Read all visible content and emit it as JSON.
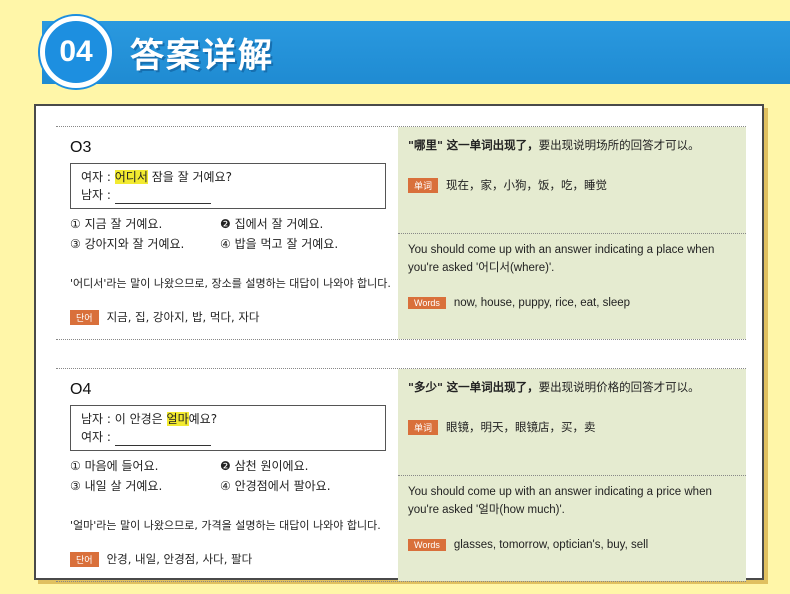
{
  "header": {
    "number": "04",
    "title": "答案详解"
  },
  "colors": {
    "header_blue": "#1f8bd2",
    "background": "#fff6a8",
    "tag_orange": "#d9703b",
    "panel_green": "#e5ebd0"
  },
  "q1": {
    "num": "O3",
    "line1_prefix": "여자 : ",
    "line1_highlight": "어디서",
    "line1_suffix": " 잠을 잘 거예요?",
    "line2_prefix": "남자 : ",
    "options": [
      "① 지금 잘 거예요.",
      "❷ 집에서 잘 거예요.",
      "③ 강아지와 잘 거예요.",
      "④ 밥을 먹고 잘 거예요."
    ],
    "explanation": "'어디서'라는 말이 나왔으므로, 장소를 설명하는 대답이 나와야 합니다.",
    "vocab_tag": "단어",
    "vocab": "지금, 집, 강아지, 밥, 먹다, 자다",
    "cn_quote": "\"哪里\"",
    "cn_bold": "这一单词出现了，",
    "cn_rest": "要出现说明场所的回答才可以。",
    "cn_tag": "单词",
    "cn_words": "现在，家，小狗，饭，吃，睡觉",
    "en_text": "You should come up with an answer indicating a place when you're asked '어디서(where)'.",
    "en_tag": "Words",
    "en_words": "now, house, puppy, rice, eat, sleep"
  },
  "q2": {
    "num": "O4",
    "line1_prefix": "남자 : 이 안경은 ",
    "line1_highlight": "얼마",
    "line1_suffix": "예요?",
    "line2_prefix": "여자 : ",
    "options": [
      "① 마음에 들어요.",
      "❷ 삼천 원이에요.",
      "③ 내일 살 거예요.",
      "④ 안경점에서 팔아요."
    ],
    "explanation": "'얼마'라는 말이 나왔으므로, 가격을 설명하는 대답이 나와야 합니다.",
    "vocab_tag": "단어",
    "vocab": "안경, 내일, 안경점, 사다, 팔다",
    "cn_quote": "\"多少\"",
    "cn_bold": "这一单词出现了，",
    "cn_rest": "要出现说明价格的回答才可以。",
    "cn_tag": "单词",
    "cn_words": "眼镜，明天，眼镜店，买，卖",
    "en_text": "You should come up with an answer indicating a price when you're asked '얼마(how much)'.",
    "en_tag": "Words",
    "en_words": "glasses, tomorrow, optician's, buy, sell"
  }
}
